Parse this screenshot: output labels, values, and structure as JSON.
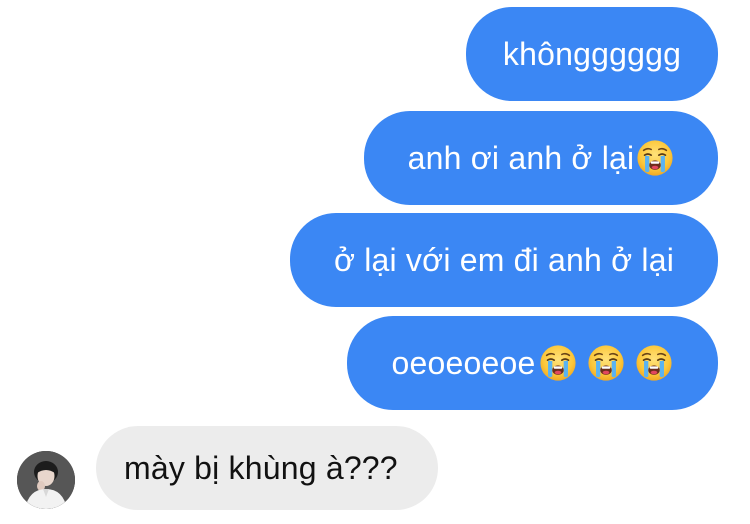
{
  "conversation": {
    "messages": [
      {
        "direction": "outgoing",
        "text": "khôngggggg"
      },
      {
        "direction": "outgoing",
        "text": "anh ơi anh ở lại",
        "emoji": [
          "loudly-crying-face"
        ]
      },
      {
        "direction": "outgoing",
        "text": "ở lại với em đi anh ở lại"
      },
      {
        "direction": "outgoing",
        "text": "oeoeoeoe",
        "emoji": [
          "loudly-crying-face",
          "loudly-crying-face",
          "loudly-crying-face"
        ]
      },
      {
        "direction": "incoming",
        "text": "mày bị khùng à???"
      }
    ]
  },
  "colors": {
    "outgoing_bubble": "#3b87f4",
    "incoming_bubble": "#ececec",
    "background": "#ffffff"
  },
  "icons": {
    "emoji": "loudly-crying-face",
    "avatar": "contact-avatar"
  }
}
